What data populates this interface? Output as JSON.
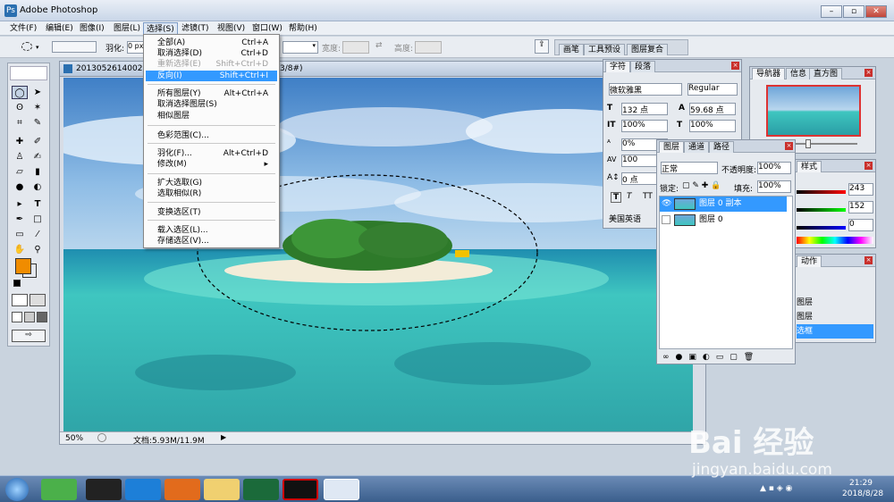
{
  "app": {
    "title": "Adobe Photoshop",
    "icon": "photoshop-icon"
  },
  "window_controls": [
    "minimize-icon",
    "restore-icon",
    "close-icon"
  ],
  "menubar": [
    "文件(F)",
    "编辑(E)",
    "图像(I)",
    "图层(L)",
    "选择(S)",
    "滤镜(T)",
    "视图(V)",
    "窗口(W)",
    "帮助(H)"
  ],
  "options": {
    "feather_label": "羽化:",
    "feather_value": "0 px",
    "width_label": "宽度:",
    "height_label": "高度:",
    "tabs": [
      "画笔",
      "工具预设",
      "图层复合"
    ]
  },
  "document": {
    "title": "20130526140022",
    "title_suffix": "3/8#)",
    "zoom": "50%",
    "doc_size": "文档:5.93M/11.9M"
  },
  "select_menu": [
    {
      "label": "全部(A)",
      "shortcut": "Ctrl+A",
      "state": "normal"
    },
    {
      "label": "取消选择(D)",
      "shortcut": "Ctrl+D",
      "state": "normal"
    },
    {
      "label": "重新选择(E)",
      "shortcut": "Shift+Ctrl+D",
      "state": "disabled"
    },
    {
      "label": "反向(I)",
      "shortcut": "Shift+Ctrl+I",
      "state": "highlighted"
    },
    {
      "label": "所有图层(Y)",
      "shortcut": "Alt+Ctrl+A",
      "state": "normal"
    },
    {
      "label": "取消选择图层(S)",
      "shortcut": "",
      "state": "normal"
    },
    {
      "label": "相似图层",
      "shortcut": "",
      "state": "normal"
    },
    {
      "label": "色彩范围(C)...",
      "shortcut": "",
      "state": "normal"
    },
    {
      "label": "羽化(F)...",
      "shortcut": "Alt+Ctrl+D",
      "state": "normal"
    },
    {
      "label": "修改(M)",
      "shortcut": "▸",
      "state": "normal"
    },
    {
      "label": "扩大选取(G)",
      "shortcut": "",
      "state": "normal"
    },
    {
      "label": "选取相似(R)",
      "shortcut": "",
      "state": "normal"
    },
    {
      "label": "变换选区(T)",
      "shortcut": "",
      "state": "normal"
    },
    {
      "label": "载入选区(L)...",
      "shortcut": "",
      "state": "normal"
    },
    {
      "label": "存储选区(V)...",
      "shortcut": "",
      "state": "normal"
    }
  ],
  "char_panel": {
    "tabs": [
      "字符",
      "段落"
    ],
    "font": "微软雅黑",
    "style": "Regular",
    "size": "132 点",
    "leading": "59.68 点",
    "vscale": "100%",
    "hscale": "100%",
    "baseline_shift": "0%",
    "tracking": "100",
    "kern": "0 点",
    "lang": "美国英语",
    "tt_buttons": [
      "T",
      "T",
      "TT"
    ]
  },
  "navigator": {
    "tabs": [
      "导航器",
      "信息",
      "直方图"
    ]
  },
  "color_panel": {
    "tab": "样式",
    "r": "243",
    "g": "152",
    "b": "0"
  },
  "layers_panel": {
    "tabs": [
      "图层",
      "通道",
      "路径"
    ],
    "blend": "正常",
    "opacity_label": "不透明度:",
    "opacity": "100%",
    "lock_label": "锁定:",
    "fill_label": "填充:",
    "fill": "100%",
    "layers": [
      {
        "name": "图层 0 副本",
        "selected": true
      },
      {
        "name": "图层 0",
        "selected": false
      }
    ]
  },
  "history_panel": {
    "tab": "动作",
    "items": [
      "图层",
      "图层",
      "选框"
    ]
  },
  "taskbar": {
    "time": "21:29",
    "date": "2018/8/28"
  },
  "watermark": {
    "line1": "Bai 经验",
    "line2": "jingyan.baidu.com"
  },
  "colors": {
    "foreground": "#f08c00",
    "highlight": "#3399ff",
    "sea": "#3fc6c0",
    "sky": "#3f7fc6"
  }
}
